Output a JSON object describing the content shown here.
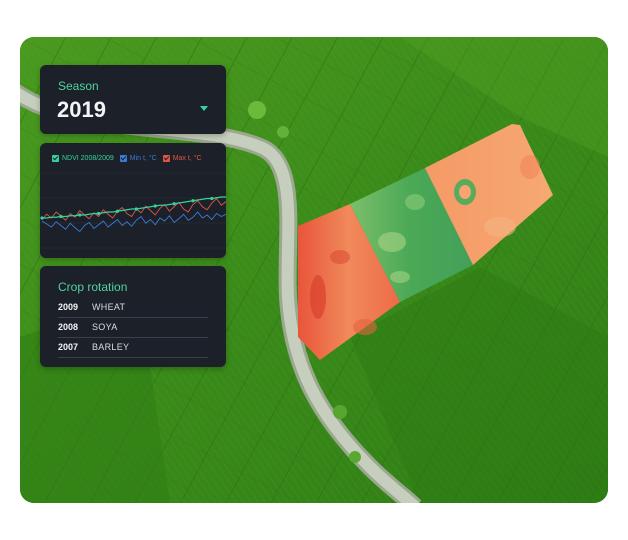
{
  "colors": {
    "accent": "#35d39b",
    "ndvi": "#35d39b",
    "min_t": "#3a7bd5",
    "max_t": "#e0554a",
    "panel_bg": "#1c2028"
  },
  "season": {
    "label": "Season",
    "value": "2019",
    "control_icon": "caret-down-icon"
  },
  "chart": {
    "legend": [
      {
        "label": "NDVI 2008/2009",
        "color": "#35d39b"
      },
      {
        "label": "Min t, °C",
        "color": "#3a7bd5"
      },
      {
        "label": "Max t, °C",
        "color": "#e0554a"
      }
    ]
  },
  "chart_data": {
    "type": "line",
    "title": "",
    "xlabel": "",
    "ylabel": "",
    "grid": true,
    "legend_position": "top",
    "x": [
      1,
      2,
      3,
      4,
      5,
      6,
      7,
      8,
      9,
      10,
      11,
      12,
      13,
      14,
      15,
      16,
      17,
      18,
      19,
      20,
      21,
      22,
      23,
      24,
      25,
      26,
      27,
      28,
      29,
      30,
      31,
      32,
      33,
      34,
      35,
      36,
      37,
      38,
      39,
      40
    ],
    "series": [
      {
        "name": "NDVI 2008/2009",
        "color": "#35d39b",
        "values": [
          0.4,
          0.4,
          0.41,
          0.41,
          0.42,
          0.42,
          0.43,
          0.43,
          0.44,
          0.44,
          0.45,
          0.46,
          0.46,
          0.47,
          0.48,
          0.48,
          0.49,
          0.5,
          0.51,
          0.52,
          0.52,
          0.53,
          0.54,
          0.55,
          0.56,
          0.57,
          0.57,
          0.58,
          0.59,
          0.6,
          0.61,
          0.62,
          0.63,
          0.64,
          0.65,
          0.66,
          0.66,
          0.67,
          0.68,
          0.68
        ]
      },
      {
        "name": "Min t, °C",
        "color": "#3a7bd5",
        "values": [
          0.36,
          0.32,
          0.28,
          0.35,
          0.3,
          0.25,
          0.33,
          0.27,
          0.22,
          0.3,
          0.34,
          0.26,
          0.31,
          0.36,
          0.28,
          0.33,
          0.38,
          0.3,
          0.35,
          0.29,
          0.37,
          0.42,
          0.33,
          0.38,
          0.31,
          0.4,
          0.36,
          0.43,
          0.34,
          0.39,
          0.45,
          0.37,
          0.41,
          0.48,
          0.4,
          0.44,
          0.38,
          0.46,
          0.42,
          0.45
        ]
      },
      {
        "name": "Max t, °C",
        "color": "#e0554a",
        "values": [
          0.38,
          0.45,
          0.4,
          0.48,
          0.43,
          0.37,
          0.46,
          0.41,
          0.5,
          0.44,
          0.39,
          0.47,
          0.42,
          0.51,
          0.45,
          0.4,
          0.49,
          0.54,
          0.46,
          0.42,
          0.52,
          0.47,
          0.56,
          0.5,
          0.44,
          0.53,
          0.58,
          0.49,
          0.55,
          0.61,
          0.52,
          0.48,
          0.58,
          0.63,
          0.55,
          0.51,
          0.6,
          0.66,
          0.57,
          0.62
        ]
      }
    ],
    "ylim": [
      0,
      1
    ]
  },
  "rotation": {
    "title": "Crop rotation",
    "rows": [
      {
        "year": "2009",
        "crop": "WHEAT"
      },
      {
        "year": "2008",
        "crop": "SOYA"
      },
      {
        "year": "2007",
        "crop": "BARLEY"
      }
    ]
  }
}
